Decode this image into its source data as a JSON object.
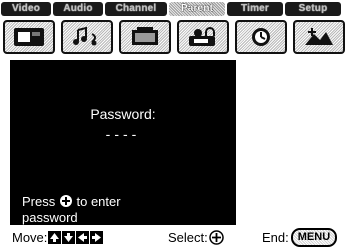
{
  "tabs": [
    {
      "label": "Video",
      "active": false
    },
    {
      "label": "Audio",
      "active": false
    },
    {
      "label": "Channel",
      "active": false
    },
    {
      "label": "Parent",
      "active": true
    },
    {
      "label": "Timer",
      "active": false
    },
    {
      "label": "Setup",
      "active": false
    }
  ],
  "icons": [
    "video-picture-icon",
    "audio-notes-icon",
    "channel-tv-icon",
    "parent-lock-icon",
    "timer-clock-icon",
    "setup-tools-icon"
  ],
  "panel": {
    "password_label": "Password:",
    "password_value": "----",
    "hint_prefix": "Press",
    "hint_suffix": "to enter",
    "hint_line2": "password"
  },
  "footer": {
    "move_label": "Move:",
    "select_label": "Select:",
    "end_label": "End:",
    "menu_button": "MENU"
  },
  "colors": {
    "panel_bg": "#000000",
    "text_light": "#ffffff",
    "page_bg": "#ffffff"
  }
}
